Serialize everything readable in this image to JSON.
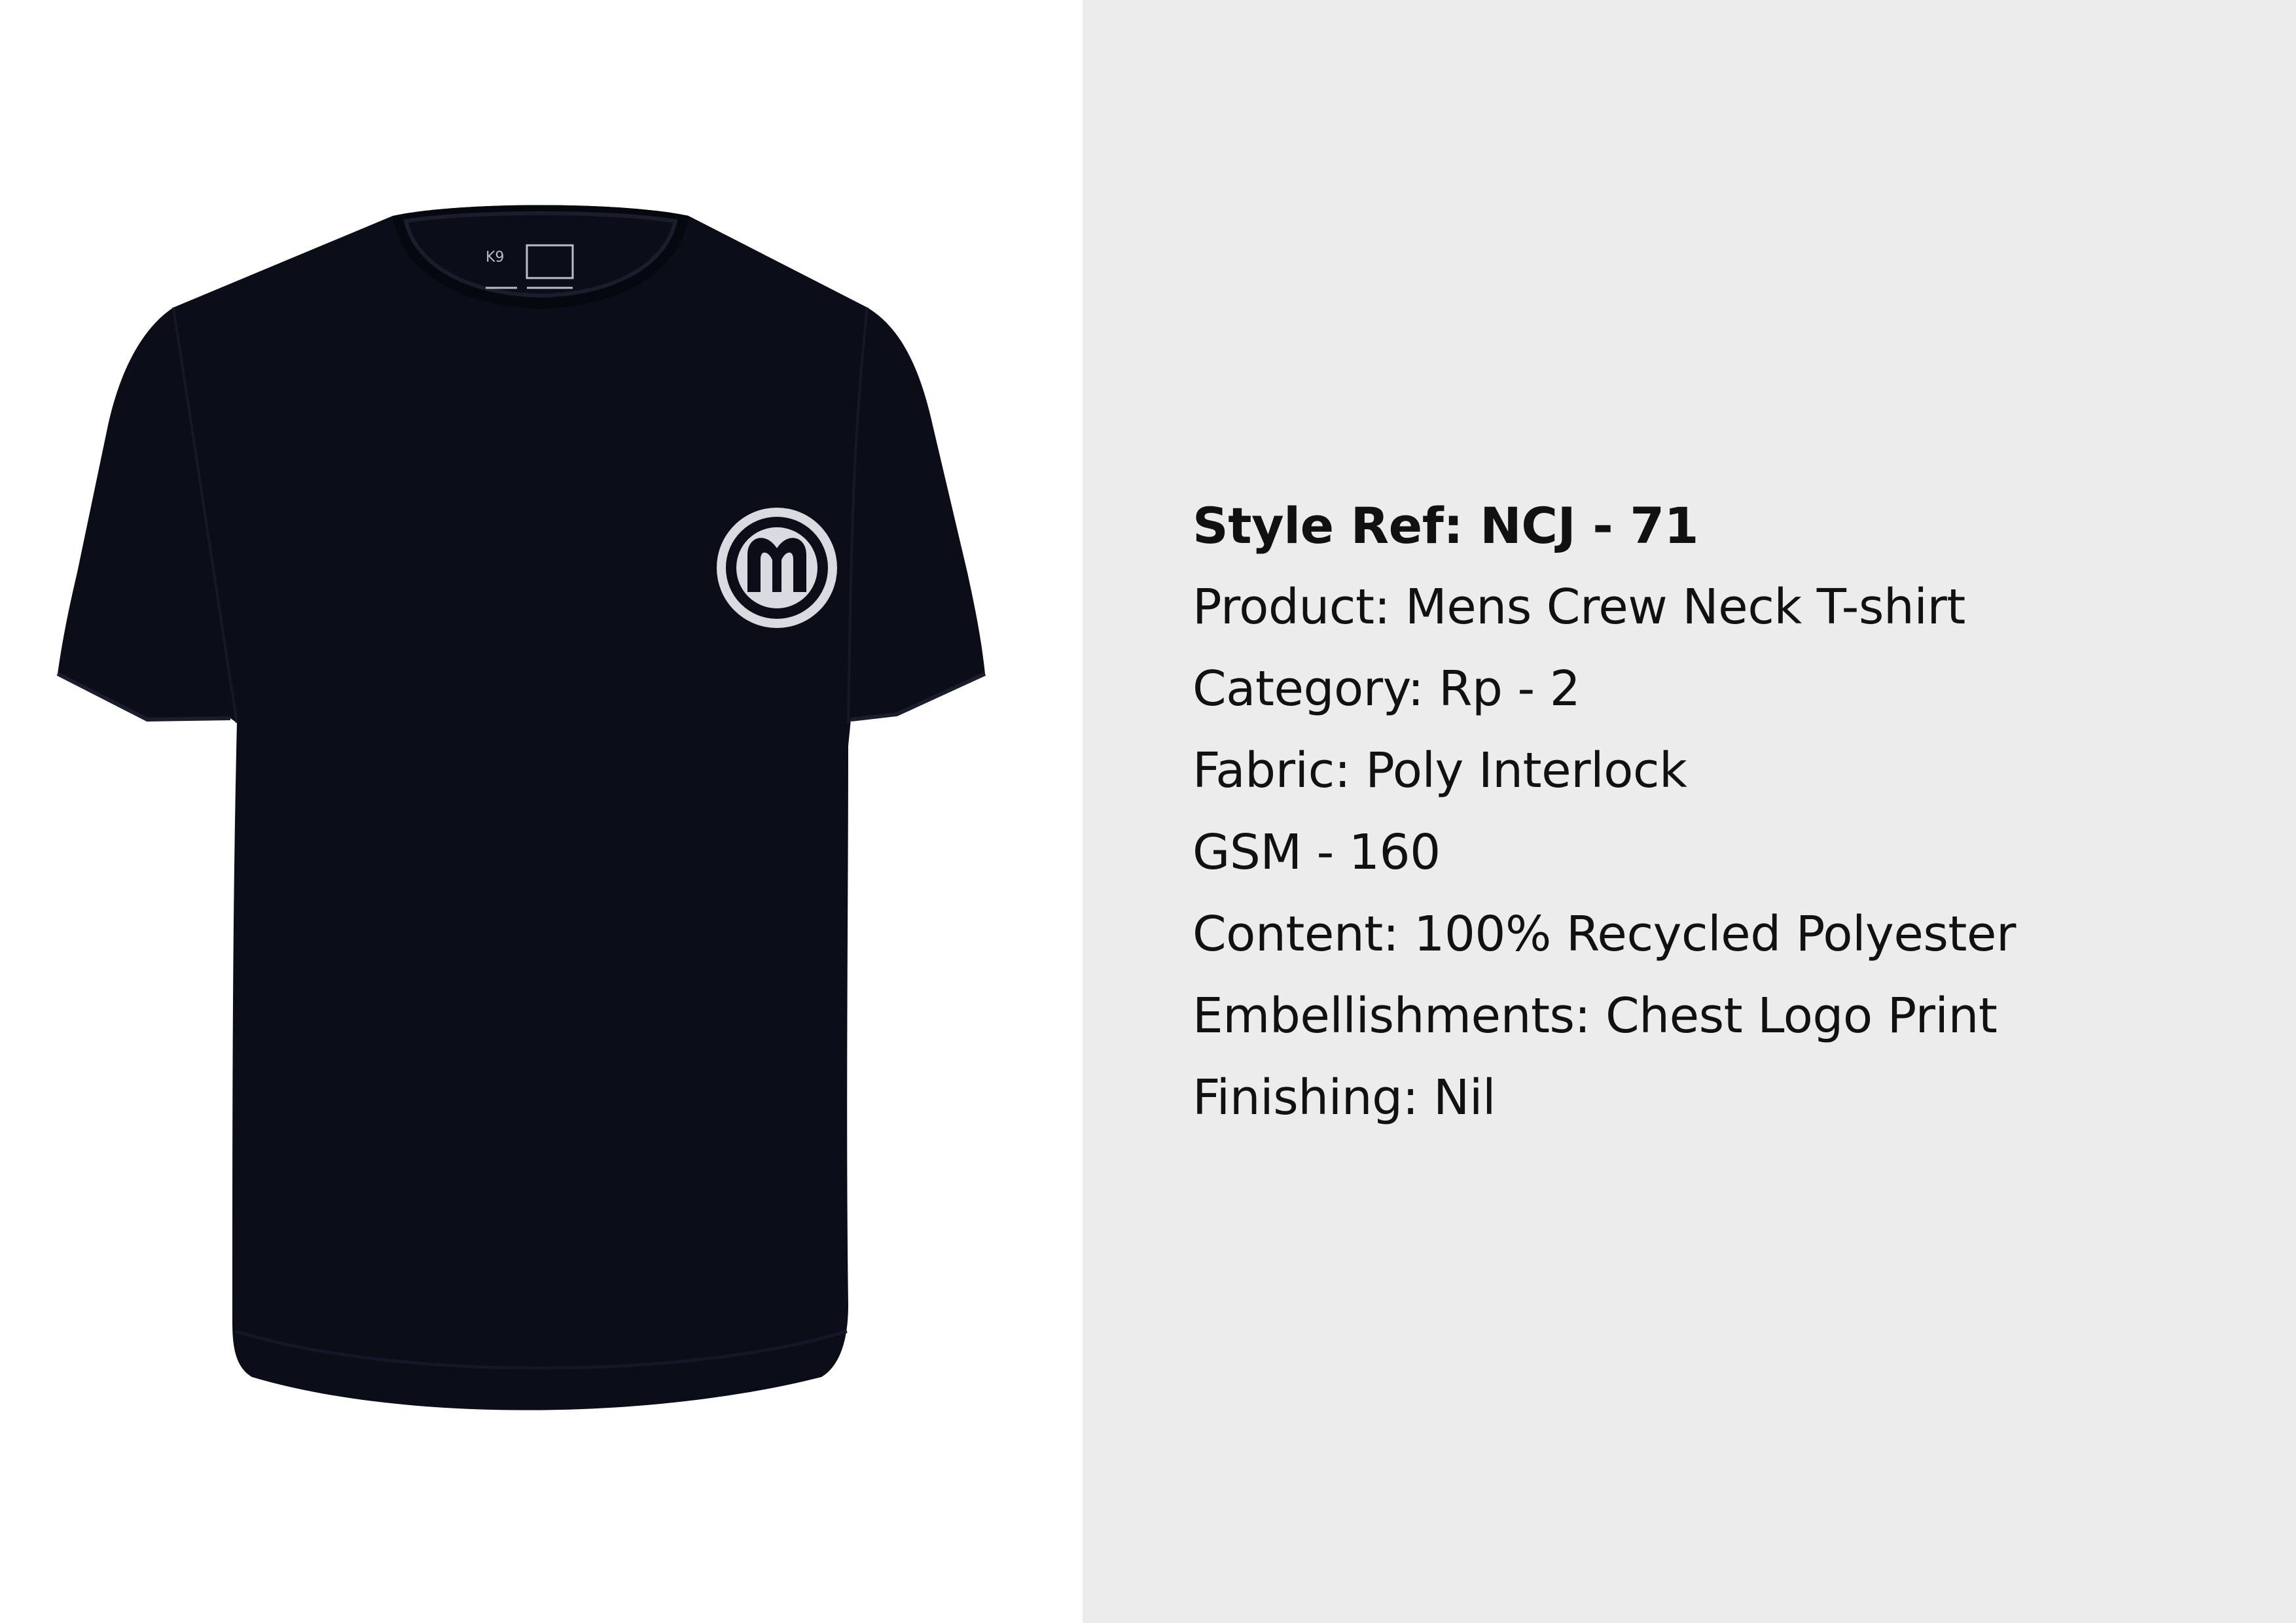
{
  "product_image": {
    "shirt_color": "#0b0e18",
    "background": "#ffffff",
    "logo_icon": "circular-m-logo-icon",
    "neck_label_icon": "neck-care-label-icon"
  },
  "spec_panel": {
    "background": "#ececec",
    "text_color": "#111111",
    "style_ref": "Style Ref: NCJ - 71",
    "product": "Product: Mens Crew Neck T-shirt",
    "category": "Category: Rp - 2",
    "fabric": "Fabric: Poly Interlock",
    "gsm": "GSM - 160",
    "content": "Content: 100% Recycled Polyester",
    "embellishments": "Embellishments: Chest Logo Print",
    "finishing": "Finishing: Nil"
  }
}
